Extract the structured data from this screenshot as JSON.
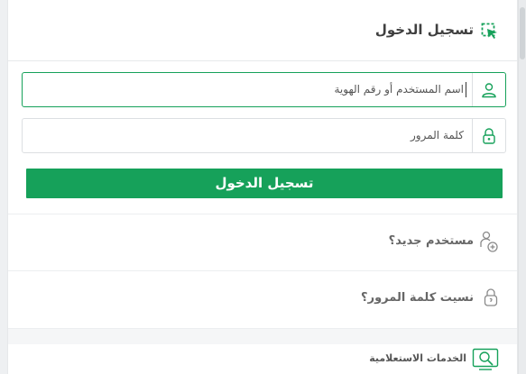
{
  "header": {
    "title": "تسجيل الدخول",
    "icon": "cursor-select-icon"
  },
  "login": {
    "username_placeholder": "اسم المستخدم أو رقم الهوية",
    "password_placeholder": "كلمة المرور",
    "username_icon": "user-icon",
    "password_icon": "lock-icon",
    "submit_label": "تسجيل الدخول"
  },
  "links": {
    "new_user": "مستخدم جديد؟",
    "forgot_password": "نسيت كلمة المرور؟"
  },
  "services": {
    "label": "الخدمات الاستعلامية",
    "icon": "search-screen-icon"
  },
  "colors": {
    "accent": "#16a15a",
    "text": "#3f3f3f",
    "muted": "#666666"
  }
}
